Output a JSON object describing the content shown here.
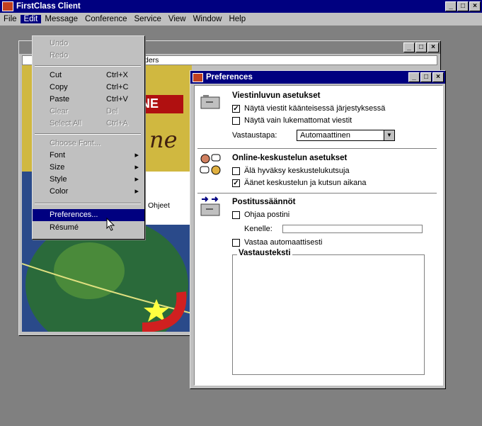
{
  "app": {
    "title": "FirstClass Client"
  },
  "menubar": [
    {
      "label": "File"
    },
    {
      "label": "Edit"
    },
    {
      "label": "Message"
    },
    {
      "label": "Conference"
    },
    {
      "label": "Service"
    },
    {
      "label": "View"
    },
    {
      "label": "Window"
    },
    {
      "label": "Help"
    }
  ],
  "folder": {
    "strip_text": "ders",
    "ad_text": "ONE",
    "ad_script": "ne",
    "help_label": "Ohjeet"
  },
  "edit_menu": {
    "undo": "Undo",
    "redo": "Redo",
    "cut": "Cut",
    "cut_sc": "Ctrl+X",
    "copy": "Copy",
    "copy_sc": "Ctrl+C",
    "paste": "Paste",
    "paste_sc": "Ctrl+V",
    "clear": "Clear",
    "clear_sc": "Del",
    "select_all": "Select All",
    "select_all_sc": "Ctrl+A",
    "choose_font": "Choose Font...",
    "font": "Font",
    "size": "Size",
    "style": "Style",
    "color": "Color",
    "preferences": "Preferences...",
    "resume": "Résumé"
  },
  "prefs": {
    "title": "Preferences",
    "s1_title": "Viestinluvun asetukset",
    "s1_opt1": "Näytä viestit käänteisessä järjestyksessä",
    "s1_opt2": "Näytä vain lukemattomat viestit",
    "s1_reply_label": "Vastaustapa:",
    "s1_reply_value": "Automaattinen",
    "s2_title": "Online-keskustelun asetukset",
    "s2_opt1": "Älä hyväksy keskustelukutsuja",
    "s2_opt2": "Äänet keskustelun ja kutsun aikana",
    "s3_title": "Postitussäännöt",
    "s3_opt1": "Ohjaa postini",
    "s3_to_label": "Kenelle:",
    "s3_opt2": "Vastaa automaattisesti",
    "s3_reply_text": "Vastausteksti"
  },
  "colors": {
    "titlebar": "#000080",
    "face": "#c0c0c0",
    "desktop": "#808080"
  }
}
